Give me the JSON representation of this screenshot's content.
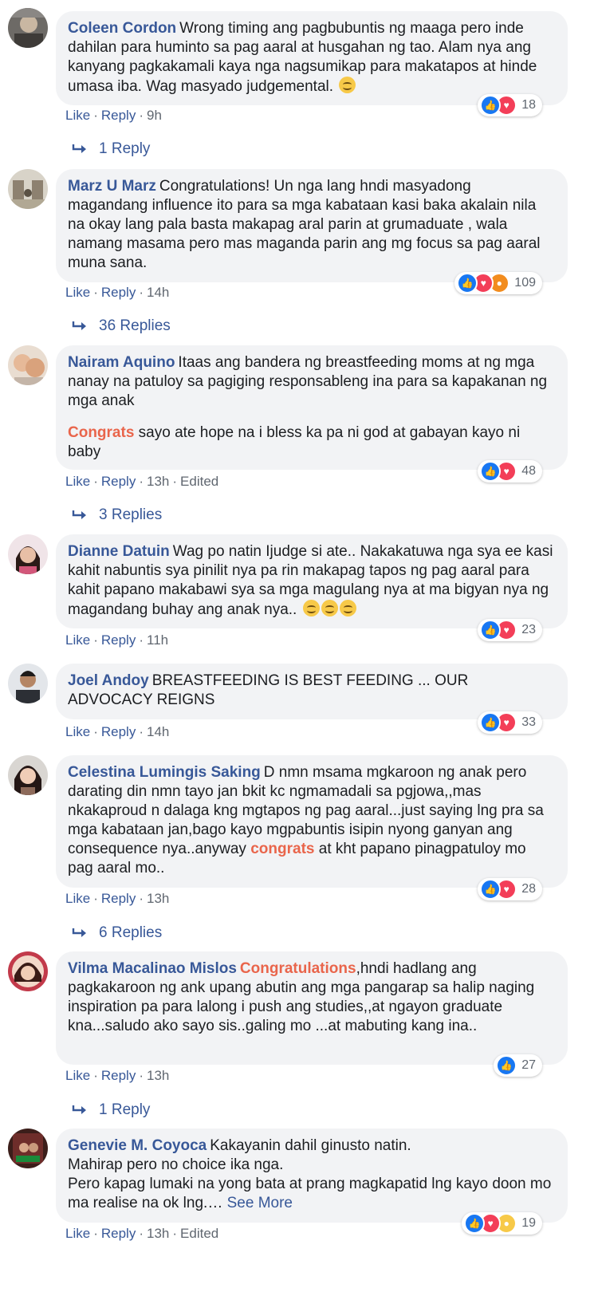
{
  "actions": {
    "like": "Like",
    "reply": "Reply",
    "edited": "Edited"
  },
  "comments": [
    {
      "author": "Coleen Cordon",
      "paragraphs": [
        [
          "Wrong timing ang pagbubuntis ng maaga pero inde dahilan para huminto sa pag aaral at husgahan ng tao. Alam nya ang kanyang pagkakamali kaya nga nagsumikap para makatapos at hinde umasa iba. Wag masyado judgemental. "
        ]
      ],
      "reaction_count": "18",
      "time": "9h",
      "replies": "1 Reply"
    },
    {
      "author": "Marz U Marz",
      "paragraphs": [
        [
          "Congratulations! Un nga lang hndi masyadong magandang influence ito para sa mga kabataan kasi baka akalain nila na okay lang pala basta makapag aral parin at grumaduate , wala namang masama pero mas maganda parin ang mg focus sa pag aaral muna sana."
        ]
      ],
      "reaction_count": "109",
      "time": "14h",
      "replies": "36 Replies"
    },
    {
      "author": "Nairam Aquino",
      "paragraphs": [
        [
          "Itaas ang bandera ng breastfeeding moms at ng mga nanay na patuloy sa pagiging responsableng ina para sa kapakanan ng mga anak"
        ],
        [
          "Congrats",
          " sayo ate hope na i bless ka pa ni god at gabayan kayo ni baby"
        ]
      ],
      "reaction_count": "48",
      "time": "13h",
      "replies": "3 Replies"
    },
    {
      "author": "Dianne Datuin",
      "paragraphs": [
        [
          "Wag po natin Ijudge si ate.. Nakakatuwa nga sya ee kasi kahit nabuntis sya pinilit nya pa rin makapag tapos ng pag aaral para kahit papano makabawi sya sa mga magulang nya at ma bigyan nya ng magandang buhay ang anak nya.. "
        ]
      ],
      "reaction_count": "23",
      "time": "11h"
    },
    {
      "author": "Joel Andoy",
      "paragraphs": [
        [
          "BREASTFEEDING IS BEST FEEDING ... OUR ADVOCACY REIGNS"
        ]
      ],
      "reaction_count": "33",
      "time": "14h"
    },
    {
      "author": "Celestina Lumingis Saking",
      "paragraphs": [
        [
          "D nmn msama mgkaroon ng anak pero darating din nmn tayo jan bkit kc ngmamadali sa pgjowa,,mas nkakaproud n dalaga kng mgtapos ng pag aaral...just saying lng pra sa mga kabataan jan,bago kayo mgpabuntis isipin nyong ganyan ang consequence nya..anyway ",
          "congrats",
          " at kht papano pinagpatuloy mo pag aaral mo.."
        ]
      ],
      "reaction_count": "28",
      "time": "13h",
      "replies": "6 Replies"
    },
    {
      "author": "Vilma Macalinao Mislos",
      "paragraphs": [
        [
          "Congratulations",
          ",hndi hadlang ang pagkakaroon ng ank upang abutin ang mga pangarap sa halip naging inspiration pa para lalong i push ang studies,,at ngayon graduate kna...saludo ako sayo sis..galing mo ...at mabuting kang ina.."
        ]
      ],
      "reaction_count": "27",
      "time": "13h",
      "replies": "1 Reply"
    },
    {
      "author": "Genevie M. Coyoca",
      "paragraphs": [
        [
          "Kakayanin dahil ginusto natin.",
          "Mahirap pero no choice ika nga.",
          "Pero kapag lumaki na yong bata at prang magkapatid lng kayo doon mo ma realise na ok lng.…",
          "See More"
        ]
      ],
      "reaction_count": "19",
      "time": "13h"
    }
  ]
}
